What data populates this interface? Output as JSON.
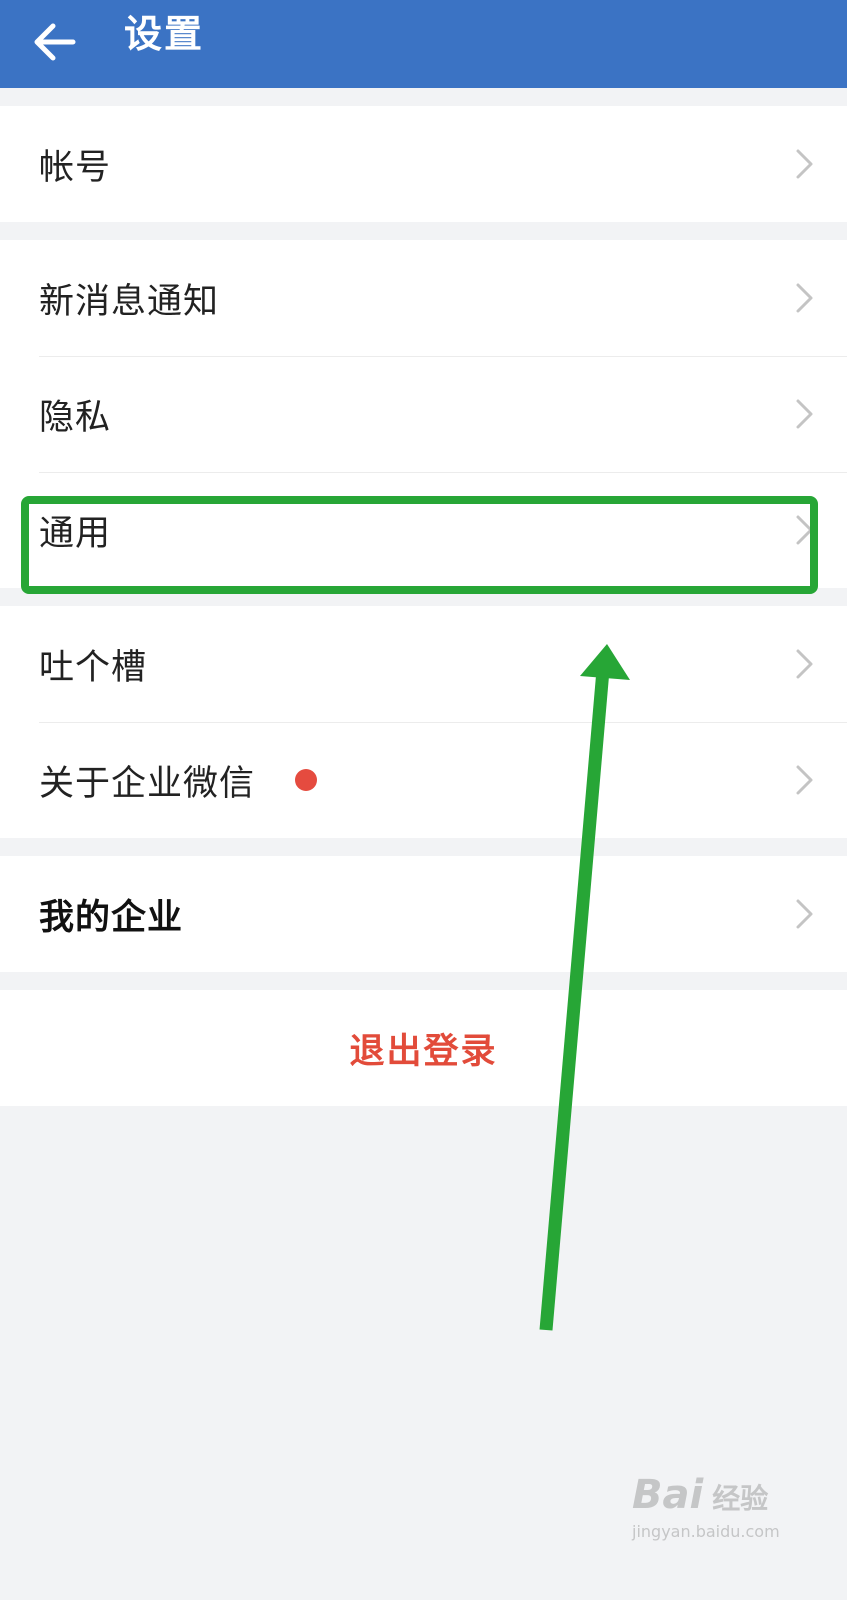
{
  "header": {
    "title": "设置",
    "back_icon": "arrow-left-icon",
    "background": "#3b73c4"
  },
  "settings": {
    "account": "帐号",
    "new_message_notification": "新消息通知",
    "privacy": "隐私",
    "general": "通用",
    "feedback": "吐个槽",
    "about": "关于企业微信",
    "my_enterprise": "我的企业",
    "chevron_icon": "chevron-right-icon",
    "about_badge_color": "#e54b3f"
  },
  "logout": {
    "label": "退出登录",
    "color": "#e24b3a"
  },
  "annotation": {
    "highlight_color": "#27a636",
    "highlight_target": "通用"
  },
  "watermark": {
    "logo": "Bai",
    "logo_suffix": "经验",
    "url": "jingyan.baidu.com"
  }
}
